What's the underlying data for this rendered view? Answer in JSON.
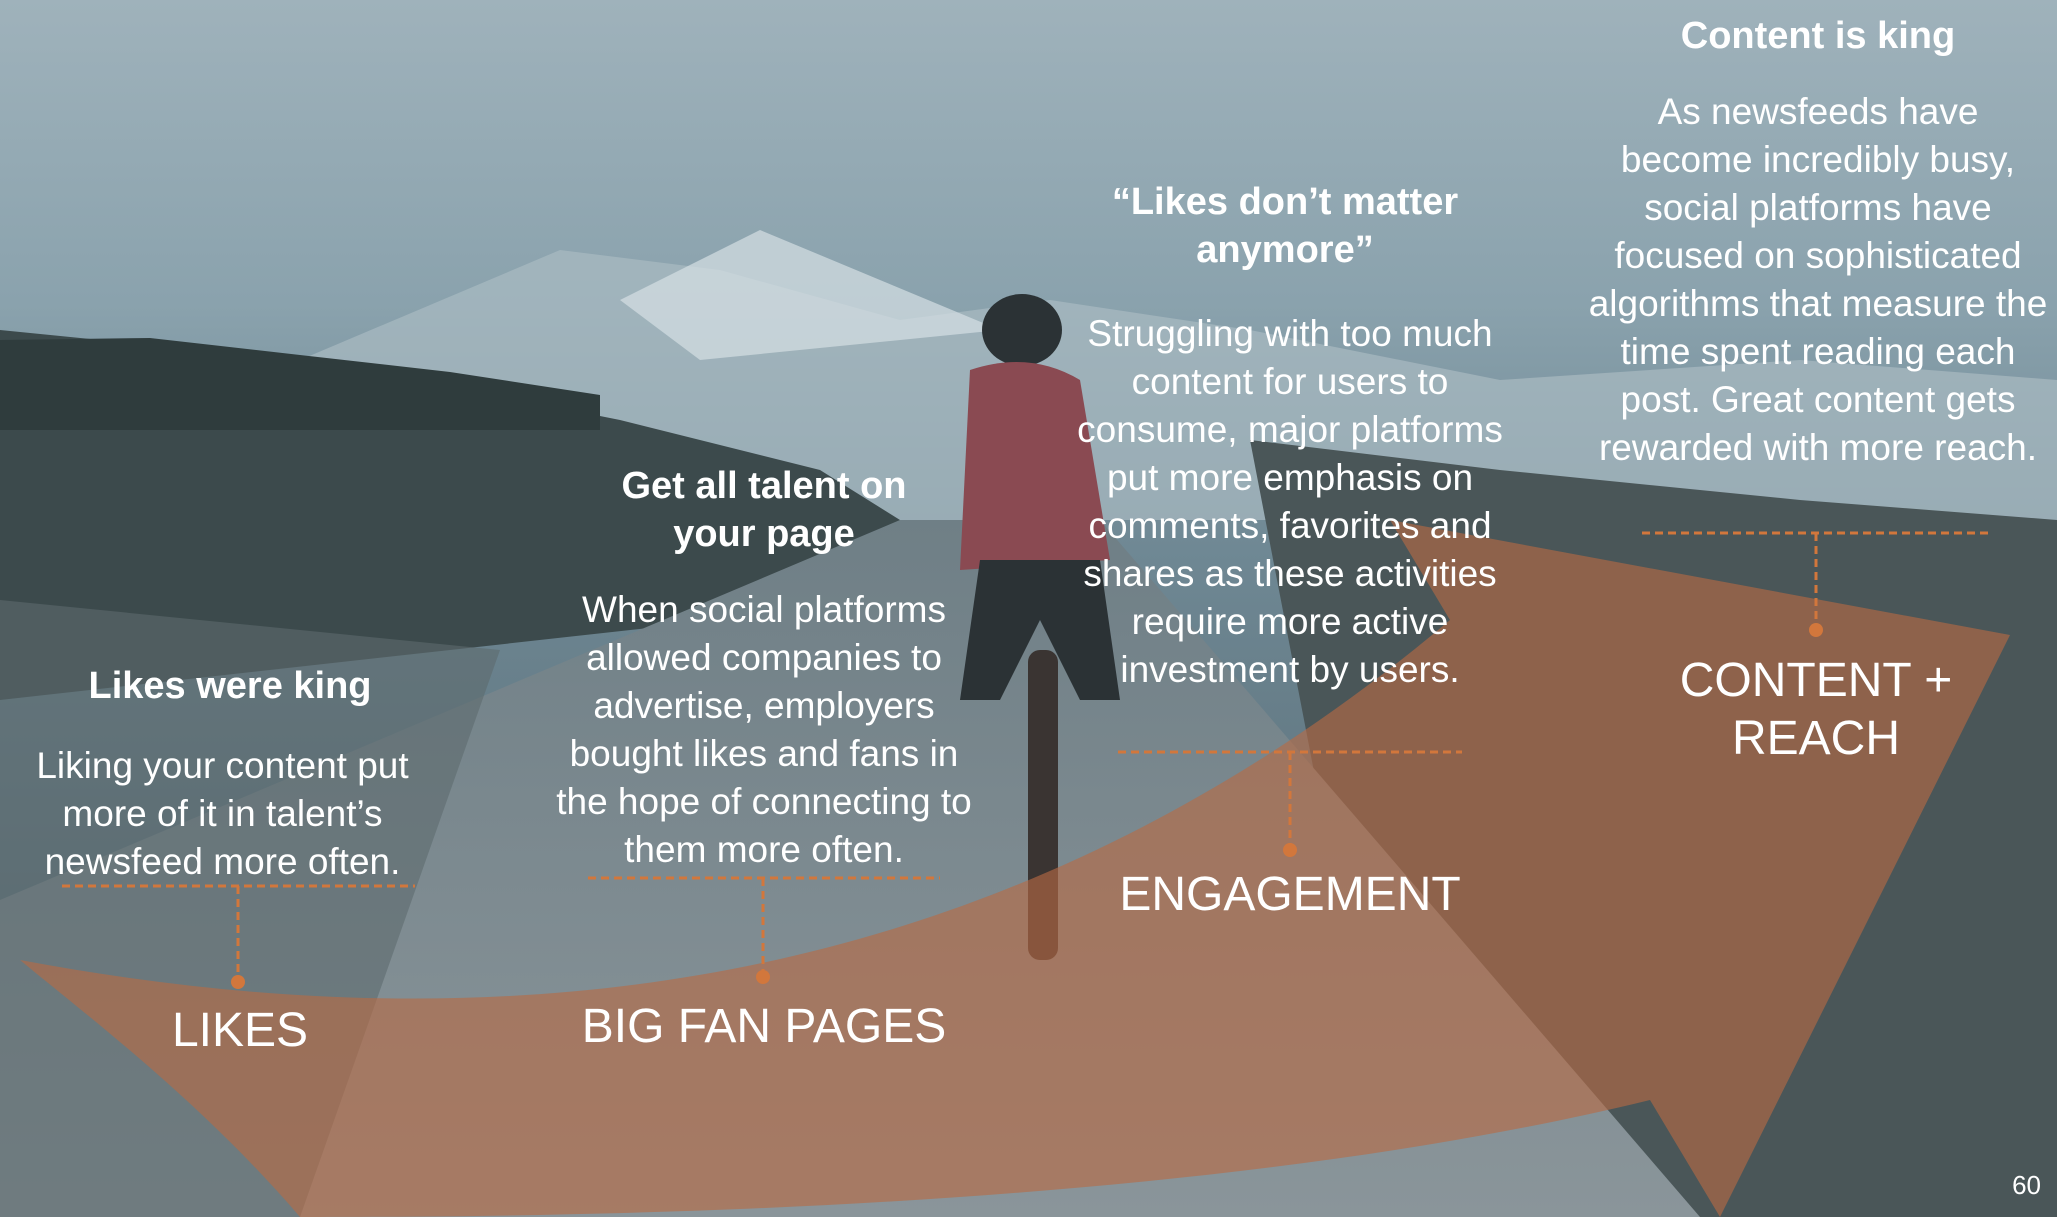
{
  "colors": {
    "accent": "#d2773c",
    "arrow_fill": "#b86a44",
    "text": "#ffffff"
  },
  "background": {
    "description_icon": "cyclist-on-mountain-road-photo"
  },
  "stages": [
    {
      "heading": "Likes were king",
      "body": "Liking your content put more of it in talent’s newsfeed more often.",
      "label": "LIKES"
    },
    {
      "heading": "Get all talent on your page",
      "body": "When social platforms allowed companies to advertise, employers bought likes and fans in the hope of connecting to them more often.",
      "label": "BIG FAN PAGES"
    },
    {
      "heading": "“Likes don’t matter anymore”",
      "body": "Struggling with too much content for users to consume, major platforms put more emphasis on comments, favorites and shares as these activities require more active investment by users.",
      "label": "ENGAGEMENT"
    },
    {
      "heading": "Content is king",
      "body": "As newsfeeds have become incredibly busy, social platforms have focused on sophisticated algorithms that measure the time spent reading each post. Great content gets rewarded with more reach.",
      "label": "CONTENT + REACH"
    }
  ],
  "page_number": "60"
}
